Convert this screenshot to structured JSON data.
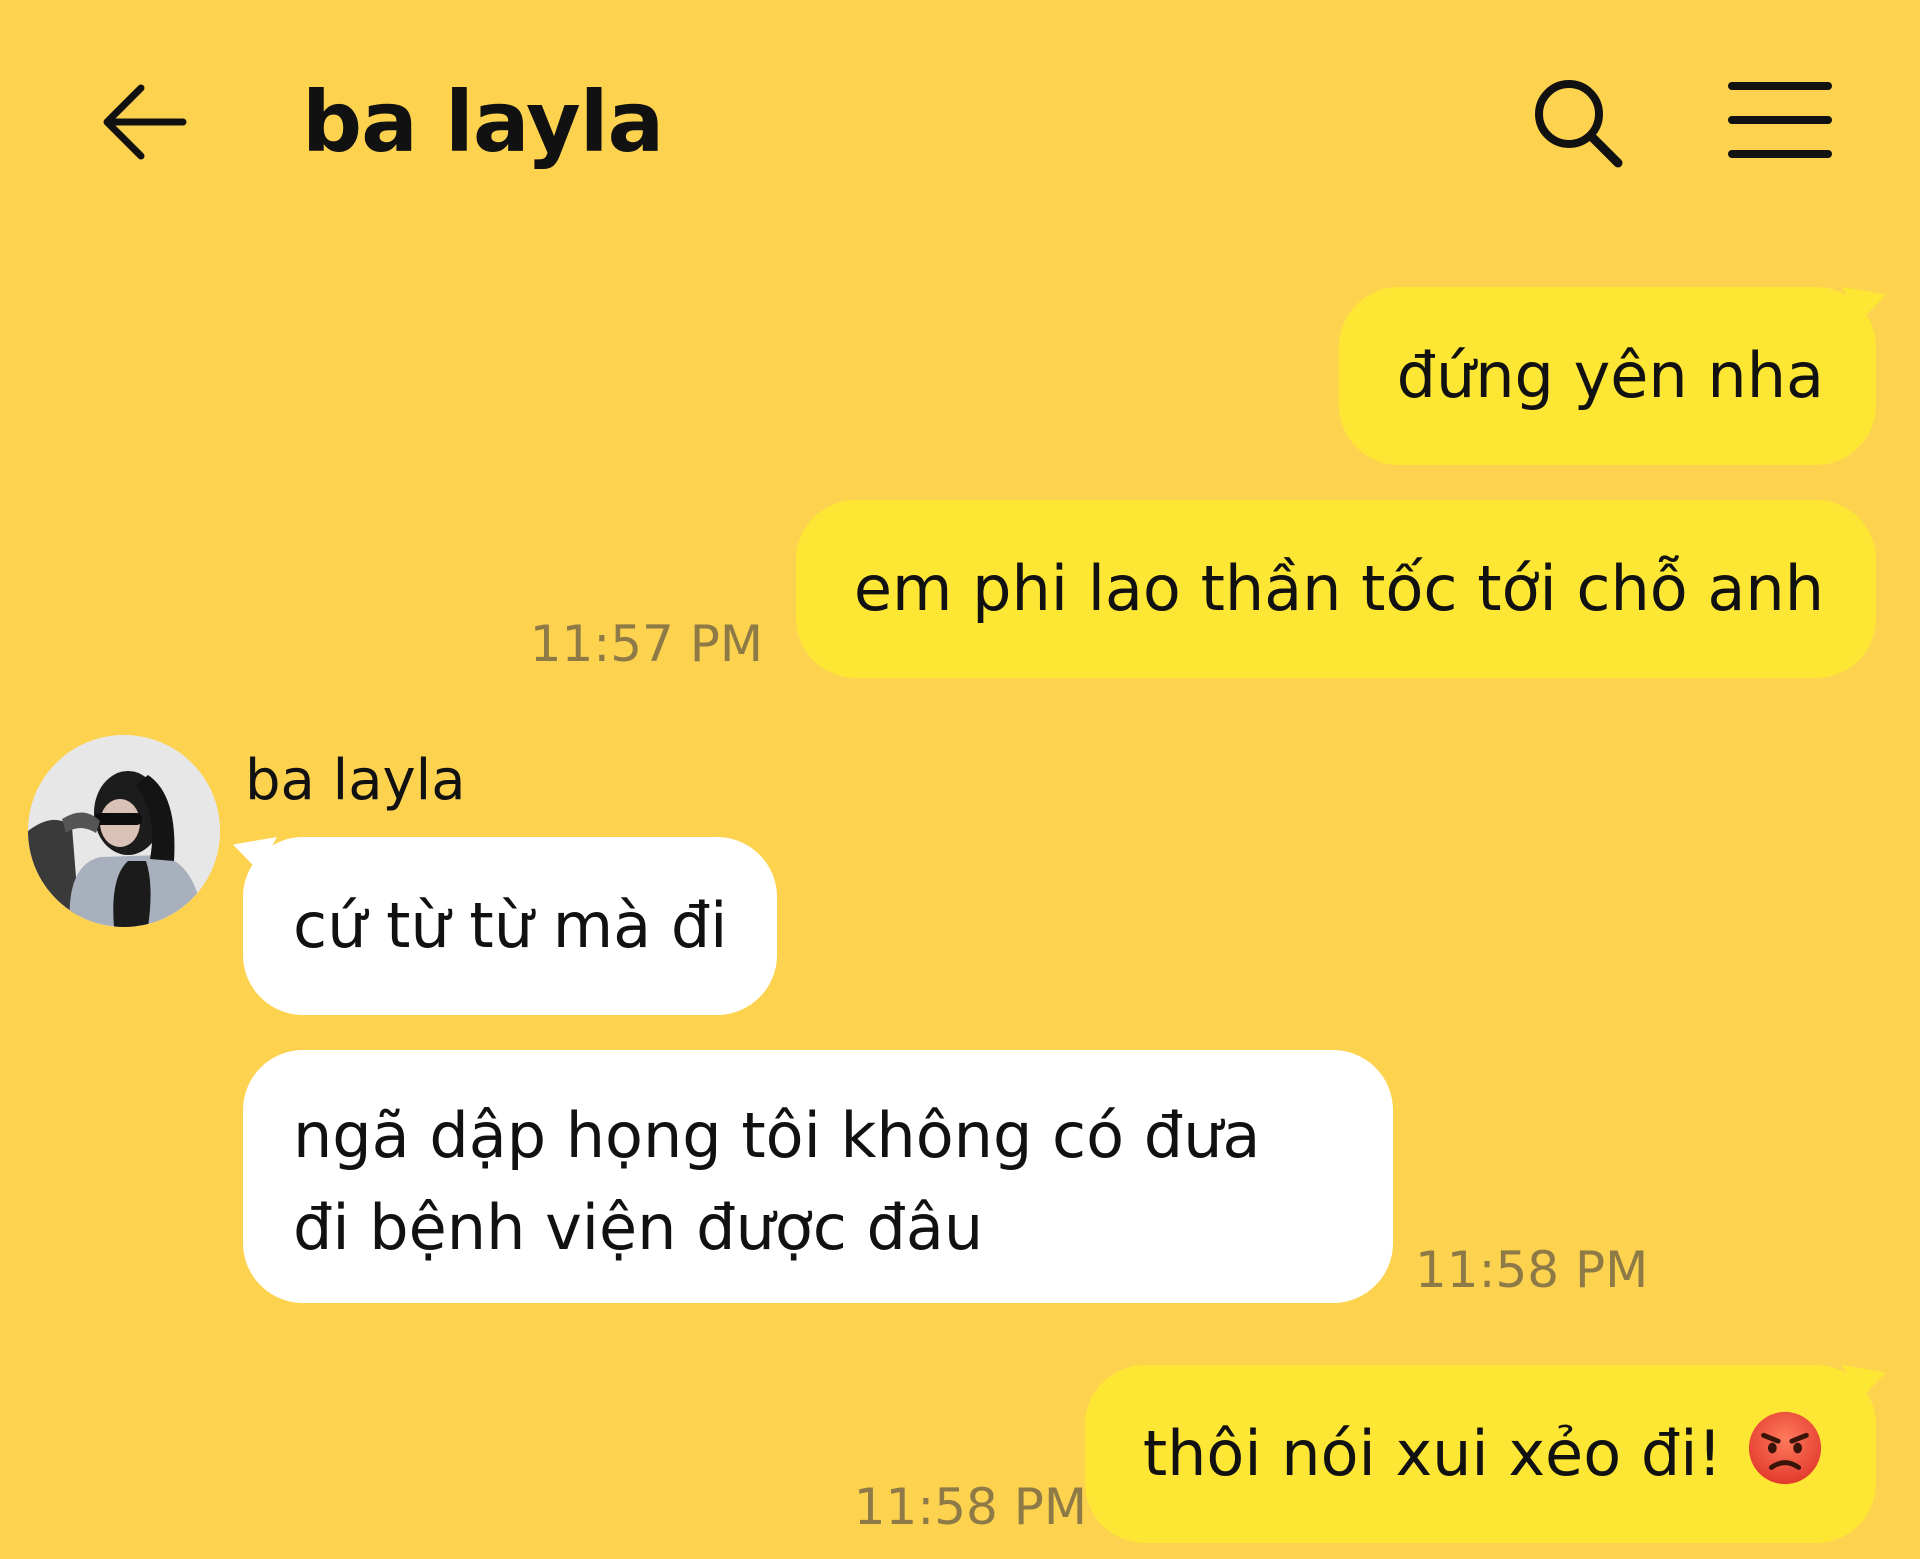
{
  "header": {
    "title": "ba layla",
    "back_icon": "arrow-left-icon",
    "search_icon": "search-icon",
    "menu_icon": "hamburger-menu-icon"
  },
  "colors": {
    "background": "#fdd24f",
    "outgoing_bubble": "#fee635",
    "incoming_bubble": "#ffffff",
    "timestamp": "#8d7a47"
  },
  "messages": [
    {
      "direction": "outgoing",
      "text": "đứng yên nha"
    },
    {
      "direction": "outgoing",
      "text": "em phi lao thần tốc tới chỗ anh",
      "time": "11:57 PM"
    },
    {
      "direction": "incoming",
      "sender": "ba layla",
      "avatar": "contact-photo",
      "text": "cứ từ từ mà đi"
    },
    {
      "direction": "incoming",
      "lines": [
        "ngã dập họng tôi không có đưa",
        "đi bệnh viện được đâu"
      ],
      "time": "11:58 PM"
    },
    {
      "direction": "outgoing",
      "text": "thôi nói xui xẻo đi!",
      "emoji": "angry-face-emoji",
      "time": "11:58 PM"
    }
  ]
}
